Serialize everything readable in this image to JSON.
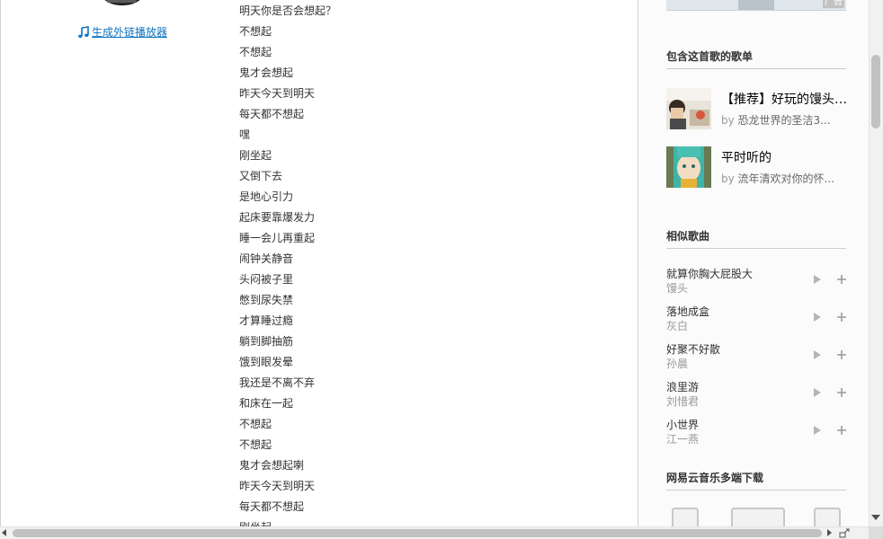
{
  "album": {
    "generate_link_label": "生成外链播放器"
  },
  "lyrics": [
    "明天你是否会想起？",
    "不想起",
    "不想起",
    "鬼才会想起",
    "昨天今天到明天",
    "每天都不想起",
    "嘿",
    "刚坐起",
    "又倒下去",
    "是地心引力",
    "起床要靠爆发力",
    "睡一会儿再重起",
    "闹钟关静音",
    "头闷被子里",
    "憋到尿失禁",
    "才算睡过瘾",
    "躺到脚抽筋",
    "饿到眼发晕",
    "我还是不离不弃",
    "和床在一起",
    "不想起",
    "不想起",
    "鬼才会想起喇",
    "昨天今天到明天",
    "每天都不想起",
    "刚坐起"
  ],
  "sidebar": {
    "ad_tag": "广告",
    "playlists_title": "包含这首歌的歌单",
    "playlists": [
      {
        "name": "【推荐】好玩的馒头…",
        "by": "by",
        "author": "恐龙世界的圣洁3..."
      },
      {
        "name": "平时听的",
        "by": "by",
        "author": "流年清欢对你的怀..."
      }
    ],
    "similar_title": "相似歌曲",
    "similar_songs": [
      {
        "name": "就算你胸大屁股大",
        "artist": "馒头"
      },
      {
        "name": "落地成盒",
        "artist": "灰白"
      },
      {
        "name": "好聚不好散",
        "artist": "孙晨"
      },
      {
        "name": "浪里游",
        "artist": "刘惜君"
      },
      {
        "name": "小世界",
        "artist": "江一燕"
      }
    ],
    "download_title": "网易云音乐多端下载",
    "download_icons": [
      "ios-device-icon",
      "pc-device-icon",
      "android-device-icon"
    ]
  },
  "colors": {
    "link": "#0c73c2",
    "text": "#333333",
    "muted": "#999999",
    "divider": "#cccccc"
  }
}
